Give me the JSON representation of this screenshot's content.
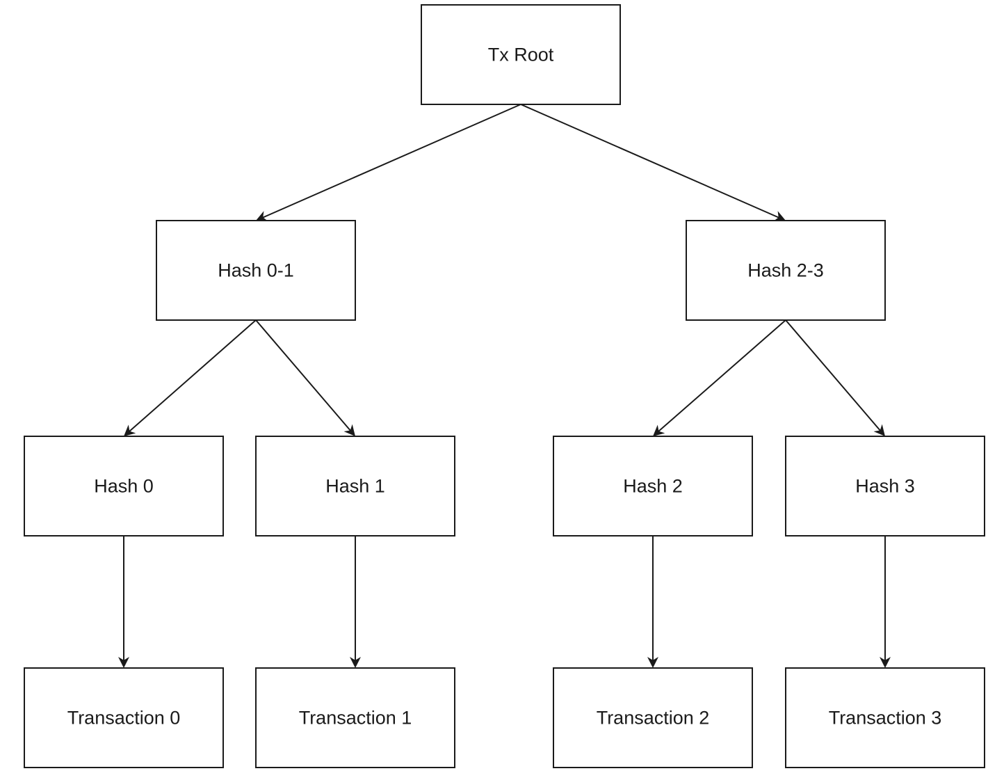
{
  "diagram": {
    "type": "merkle-tree",
    "nodes": [
      {
        "id": "root",
        "label": "Tx Root"
      },
      {
        "id": "h01",
        "label": "Hash 0-1"
      },
      {
        "id": "h23",
        "label": "Hash 2-3"
      },
      {
        "id": "h0",
        "label": "Hash 0"
      },
      {
        "id": "h1",
        "label": "Hash 1"
      },
      {
        "id": "h2",
        "label": "Hash 2"
      },
      {
        "id": "h3",
        "label": "Hash 3"
      },
      {
        "id": "t0",
        "label": "Transaction 0"
      },
      {
        "id": "t1",
        "label": "Transaction 1"
      },
      {
        "id": "t2",
        "label": "Transaction 2"
      },
      {
        "id": "t3",
        "label": "Transaction 3"
      }
    ],
    "edges": [
      {
        "from": "root",
        "to": "h01"
      },
      {
        "from": "root",
        "to": "h23"
      },
      {
        "from": "h01",
        "to": "h0"
      },
      {
        "from": "h01",
        "to": "h1"
      },
      {
        "from": "h23",
        "to": "h2"
      },
      {
        "from": "h23",
        "to": "h3"
      },
      {
        "from": "h0",
        "to": "t0"
      },
      {
        "from": "h1",
        "to": "t1"
      },
      {
        "from": "h2",
        "to": "t2"
      },
      {
        "from": "h3",
        "to": "t3"
      }
    ]
  }
}
